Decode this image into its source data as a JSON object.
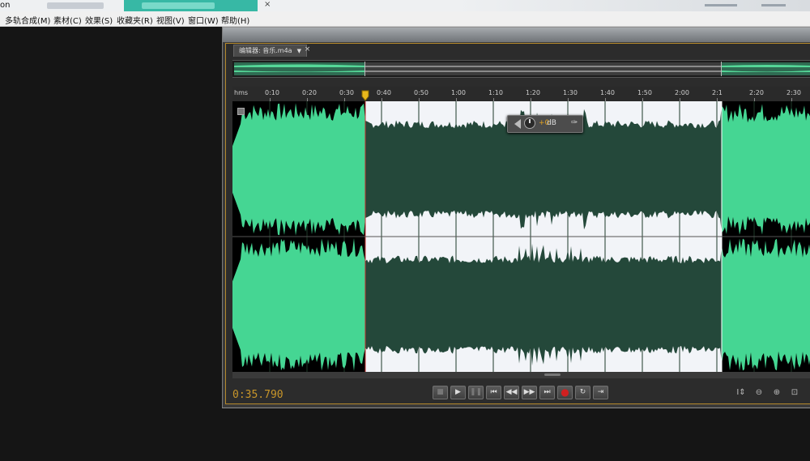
{
  "taskbar": {
    "title_fragment": "on",
    "close_symbol": "×"
  },
  "menubar": {
    "items": [
      "多轨合成(M)",
      "素材(C)",
      "效果(S)",
      "收藏夹(R)",
      "视图(V)",
      "窗口(W)",
      "帮助(H)"
    ]
  },
  "editor": {
    "tab_label": "编辑器: 音乐.m4a",
    "tab_menu_icon": "▼",
    "tab_close_icon": "×",
    "ruler": {
      "unit_label": "hms",
      "labels": [
        "0:10",
        "0:20",
        "0:30",
        "0:40",
        "0:50",
        "1:00",
        "1:10",
        "1:20",
        "1:30",
        "1:40",
        "1:50",
        "2:00",
        "2:1",
        "2:20",
        "2:30"
      ]
    },
    "hud": {
      "volume_value": "+0",
      "volume_unit": "dB",
      "pin_icon": "pin-icon"
    },
    "selection_color": "#f2f4f8",
    "waveform_color": "#45d693",
    "selected_wave_color": "#24483a",
    "playhead_color": "#f0c020",
    "current_time": "0:35.790",
    "transport": {
      "stop": "■",
      "play": "▶",
      "pause": "❚❚",
      "goto_start": "⏮",
      "rewind": "◀◀",
      "fast_forward": "▶▶",
      "goto_end": "⏭",
      "record": "●",
      "loop": "↻",
      "skip_selection": "⇥"
    },
    "zoom_tools": {
      "zoom_in_amplitude": "I⇕",
      "zoom_out_amplitude": "⊖",
      "zoom_in_time": "⊕",
      "zoom_full": "⊡"
    }
  }
}
